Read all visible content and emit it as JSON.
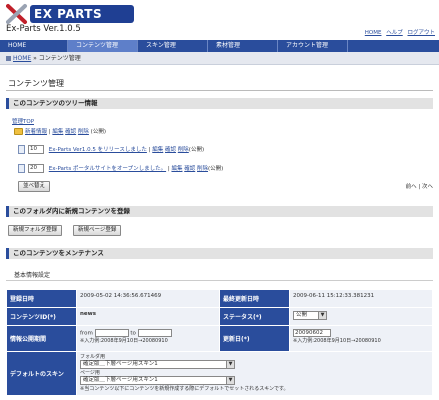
{
  "header": {
    "logo_text": "EX PARTS",
    "version": "Ex-Parts Ver.1.0.5",
    "links": [
      "HOME",
      "ヘルプ",
      "ログアウト"
    ]
  },
  "nav": {
    "items": [
      "HOME",
      "コンテンツ管理",
      "スキン管理",
      "素材管理",
      "アカウント管理"
    ]
  },
  "breadcrumb": {
    "home": "HOME",
    "current": "コンテンツ管理"
  },
  "page": {
    "title": "コンテンツ管理"
  },
  "tree": {
    "heading": "このコンテンツのツリー情報",
    "top_link": "管理TOP",
    "folder": {
      "label": "新着情報",
      "edit": "編集",
      "confirm": "確認",
      "delete": "削除",
      "status": "(公開)"
    },
    "items": [
      {
        "order": "10",
        "title": "Ex-Parts Ver1.0.5 をリリースしました",
        "edit": "編集",
        "confirm": "確認",
        "delete": "削除",
        "status": "(公開)"
      },
      {
        "order": "20",
        "title": "Ex-Parts ポータルサイトをオープンしました。",
        "edit": "編集",
        "confirm": "確認",
        "delete": "削除",
        "status": "(公開)"
      }
    ],
    "sort_button": "並べ替え",
    "pager": {
      "prev": "前へ",
      "sep": "|",
      "next": "次へ"
    }
  },
  "register": {
    "heading": "このフォルダ内に新規コンテンツを登録",
    "new_folder": "新規フォルダ登録",
    "new_page": "新規ページ登録"
  },
  "maintain": {
    "heading": "このコンテンツをメンテナンス",
    "subheading": "基本情報設定",
    "reg_date_label": "登録日時",
    "reg_date_value": "2009-05-02 14:36:56.671469",
    "upd_date_label": "最終更新日時",
    "upd_date_value": "2009-06-11 15:12:33.381231",
    "content_id_label": "コンテンツID(*)",
    "content_id_value": "news",
    "status_label": "ステータス(*)",
    "status_value": "公開",
    "period_label": "情報公開期間",
    "period_from": "from",
    "period_to": "to",
    "period_note": "※入力例:2008年9月10日→20080910",
    "upd_label": "更新日(*)",
    "upd_value": "20090602",
    "upd_note": "※入力例:2008年9月10日→20080910",
    "skin_label": "デフォルトのスキン",
    "skin_folder_caption": "フォルダ用",
    "skin_folder_value": "確定版＿下層ページ用スキン1",
    "skin_page_caption": "ページ用",
    "skin_page_value": "確定版＿下層ページ用スキン1",
    "skin_note": "※当コンテンツ以下にコンテンツを新規作成する際にデフォルトでセットされるスキンです。"
  }
}
